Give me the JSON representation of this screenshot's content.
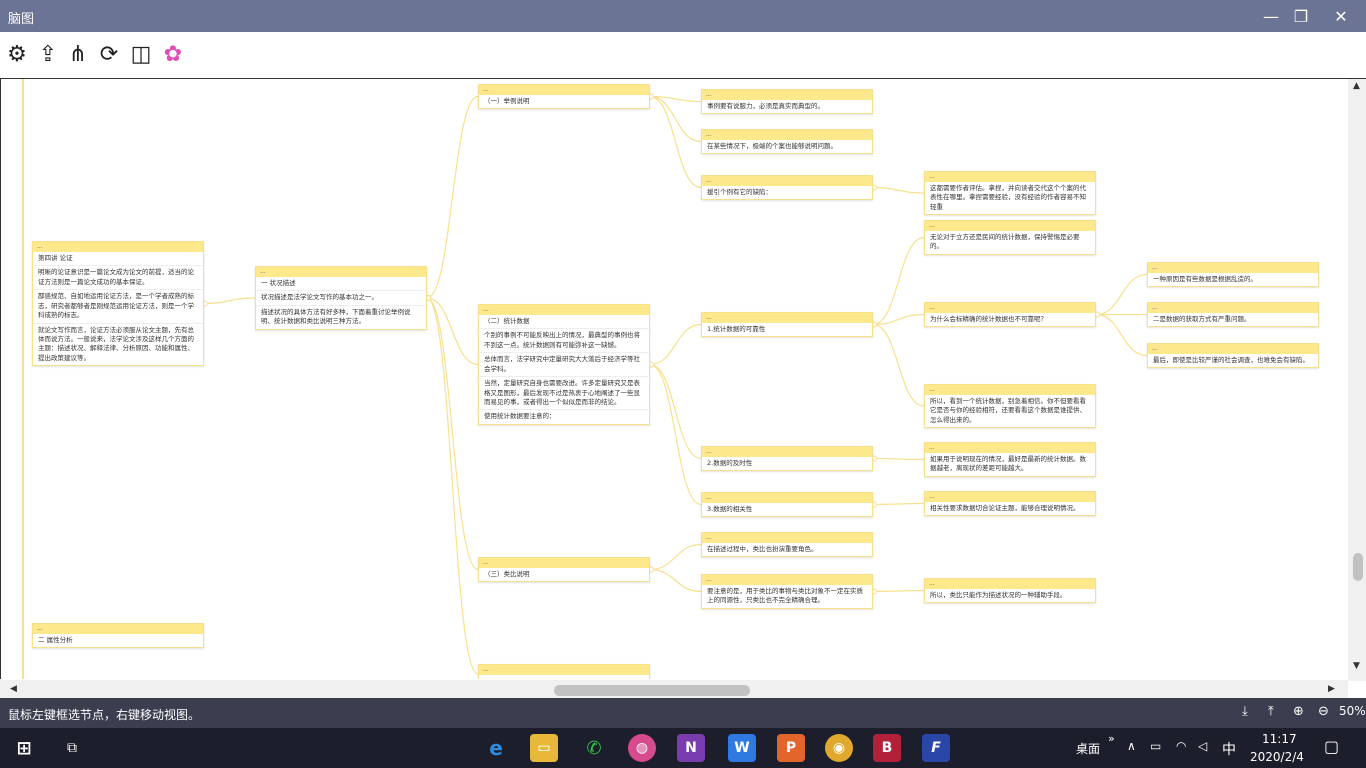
{
  "window": {
    "title": "脑图"
  },
  "toolbar": {
    "items": [
      {
        "name": "settings-icon",
        "glyph": "⚙"
      },
      {
        "name": "export-icon",
        "glyph": "⇪"
      },
      {
        "name": "structure-icon",
        "glyph": "⋔"
      },
      {
        "name": "refresh-icon",
        "glyph": "⟳"
      },
      {
        "name": "layout-icon",
        "glyph": "◫"
      },
      {
        "name": "color-palette-icon",
        "glyph": "✿"
      }
    ]
  },
  "mindmap": {
    "nodes": [
      {
        "id": "ch4",
        "head": "...",
        "lines": [
          "第四讲 论证",
          "明晰的论证意识是一篇论文成为论文的前提，适当的论证方法则是一篇论文成功的基本保证。",
          "鄙惑规范、自如地运用论证方法，是一个学者成熟的标志，研究者都够者是刚规范运用论证方法，则是一个学科成熟的标志。",
          "就论文写作而言，论证方法必须服从论文主题，先有总体而说方法。一般说来，法学论文涉及这样几个方面的主题：描述状况、解释法律、分析原因、功能和属性、提出政策建议等。"
        ]
      },
      {
        "id": "s1",
        "head": "...",
        "lines": [
          "一 状况描述",
          "状况描述是法学论文写作的基本功之一。",
          "描述状况的具体方法有好多种，下面着重讨论举例说明、统计数据和类比说明三种方法。"
        ]
      },
      {
        "id": "s2",
        "head": "...",
        "lines": [
          "二 属性分析"
        ]
      },
      {
        "id": "a",
        "head": "...",
        "lines": [
          "（一）举例说明"
        ]
      },
      {
        "id": "b",
        "head": "...",
        "lines": [
          "（二）统计数据",
          "个别的事例不可能反映出上的情况，最典型的事例也将不到这一点。统计数据则有可能弥补这一缺憾。",
          "总体而言，法学研究中定量研究大大落后于经济学等社会学科。",
          "当然，定量研究自身也需要改进。许多定量研究又是表格又是图形，最后发现不过是热衷于心地阐述了一些显而易见的事，或者得出一个似似是而非的结论。",
          "使用统计数据要注意的："
        ]
      },
      {
        "id": "c",
        "head": "...",
        "lines": [
          "（三）类比说明"
        ]
      },
      {
        "id": "d",
        "head": "...",
        "lines": [
          ""
        ]
      },
      {
        "id": "a1",
        "head": "...",
        "lines": [
          "事例要有说服力，必须是真实而典型的。"
        ]
      },
      {
        "id": "a2",
        "head": "...",
        "lines": [
          "在某些情况下，极端的个案也能够说明问题。"
        ]
      },
      {
        "id": "a3",
        "head": "...",
        "lines": [
          "援引个例有它的缺陷："
        ]
      },
      {
        "id": "a3x",
        "head": "...",
        "lines": [
          "这都需要作者评估。拿捏，并向读者交代这个个案的代表性在哪里。拿捏需要经验，没有经验的作者容易不知轻重"
        ]
      },
      {
        "id": "b1",
        "head": "...",
        "lines": [
          "1.统计数据的可靠性"
        ]
      },
      {
        "id": "b2",
        "head": "...",
        "lines": [
          "2.数据的及时性"
        ]
      },
      {
        "id": "b3",
        "head": "...",
        "lines": [
          "3.数据的相关性"
        ]
      },
      {
        "id": "b1a",
        "head": "...",
        "lines": [
          "无论对于立方还是民间的统计数据，保持警惕是必要的。"
        ]
      },
      {
        "id": "b1b",
        "head": "...",
        "lines": [
          "为什么会标精确的统计数据也不可靠呢？"
        ]
      },
      {
        "id": "b1c",
        "head": "...",
        "lines": [
          "所以，看到一个统计数据，别急着相信。你不但要看看它是否与你的经验相符，还要看看这个数据是谁提供、怎么得出来的。"
        ]
      },
      {
        "id": "b1b1",
        "head": "...",
        "lines": [
          "一种原因是有些数据是根据乱造的。"
        ]
      },
      {
        "id": "b1b2",
        "head": "...",
        "lines": [
          "二是数据的获取方式有严重问题。"
        ]
      },
      {
        "id": "b1b3",
        "head": "...",
        "lines": [
          "最后，即使是比较严谨的社会调查，也难免会有缺陷。"
        ]
      },
      {
        "id": "b2a",
        "head": "...",
        "lines": [
          "如果用于说明现在的情况，最好是最新的统计数据。数据越老，离现状的差距可能越大。"
        ]
      },
      {
        "id": "b3a",
        "head": "...",
        "lines": [
          "相关性要求数据切合论证主题，能够合理说明情况。"
        ]
      },
      {
        "id": "c1",
        "head": "...",
        "lines": [
          "在描述过程中，类比也扮演重要角色。"
        ]
      },
      {
        "id": "c2",
        "head": "...",
        "lines": [
          "要注意的是，用于类比的事物与类比对象不一定在实质上的同源性，只类比也不完全精确合理。"
        ]
      },
      {
        "id": "c2a",
        "head": "...",
        "lines": [
          "所以，类比只能作为描述状况的一种辅助手段。"
        ]
      }
    ]
  },
  "scroll": {
    "vertical": 0.84,
    "horizontal": 0.45
  },
  "status": {
    "message": "鼠标左键框选节点，右键移动视图。",
    "zoom": "50%"
  },
  "taskbar": {
    "desktop_label": "桌面",
    "ime": "中",
    "time": "11:17",
    "date": "2020/2/4"
  },
  "colors": {
    "node_head": "#fde88c",
    "link": "#f8e08e",
    "titlebar": "#6b7494",
    "statusbar": "#3a3e4f"
  }
}
